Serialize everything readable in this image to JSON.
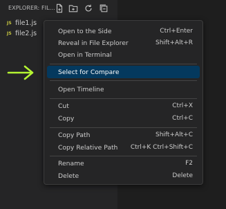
{
  "explorer": {
    "title": "EXPLORER: FIL...",
    "header_icons": [
      "new-file-icon",
      "new-folder-icon",
      "refresh-icon",
      "collapse-all-icon"
    ],
    "files": [
      {
        "badge": "JS",
        "name": "file1.js"
      },
      {
        "badge": "JS",
        "name": "file2.js"
      }
    ]
  },
  "colors": {
    "js_badge": "#cbcb41",
    "arrow": "#b5f532",
    "highlight": "#04395e",
    "menu_bg": "#252526"
  },
  "context_menu": {
    "groups": [
      [
        {
          "label": "Open to the Side",
          "shortcut": "Ctrl+Enter"
        },
        {
          "label": "Reveal in File Explorer",
          "shortcut": "Shift+Alt+R"
        },
        {
          "label": "Open in Terminal",
          "shortcut": ""
        }
      ],
      [
        {
          "label": "Select for Compare",
          "shortcut": "",
          "highlighted": true
        }
      ],
      [
        {
          "label": "Open Timeline",
          "shortcut": ""
        }
      ],
      [
        {
          "label": "Cut",
          "shortcut": "Ctrl+X"
        },
        {
          "label": "Copy",
          "shortcut": "Ctrl+C"
        }
      ],
      [
        {
          "label": "Copy Path",
          "shortcut": "Shift+Alt+C"
        },
        {
          "label": "Copy Relative Path",
          "shortcut": "Ctrl+K Ctrl+Shift+C"
        }
      ],
      [
        {
          "label": "Rename",
          "shortcut": "F2"
        },
        {
          "label": "Delete",
          "shortcut": "Delete"
        }
      ]
    ]
  }
}
